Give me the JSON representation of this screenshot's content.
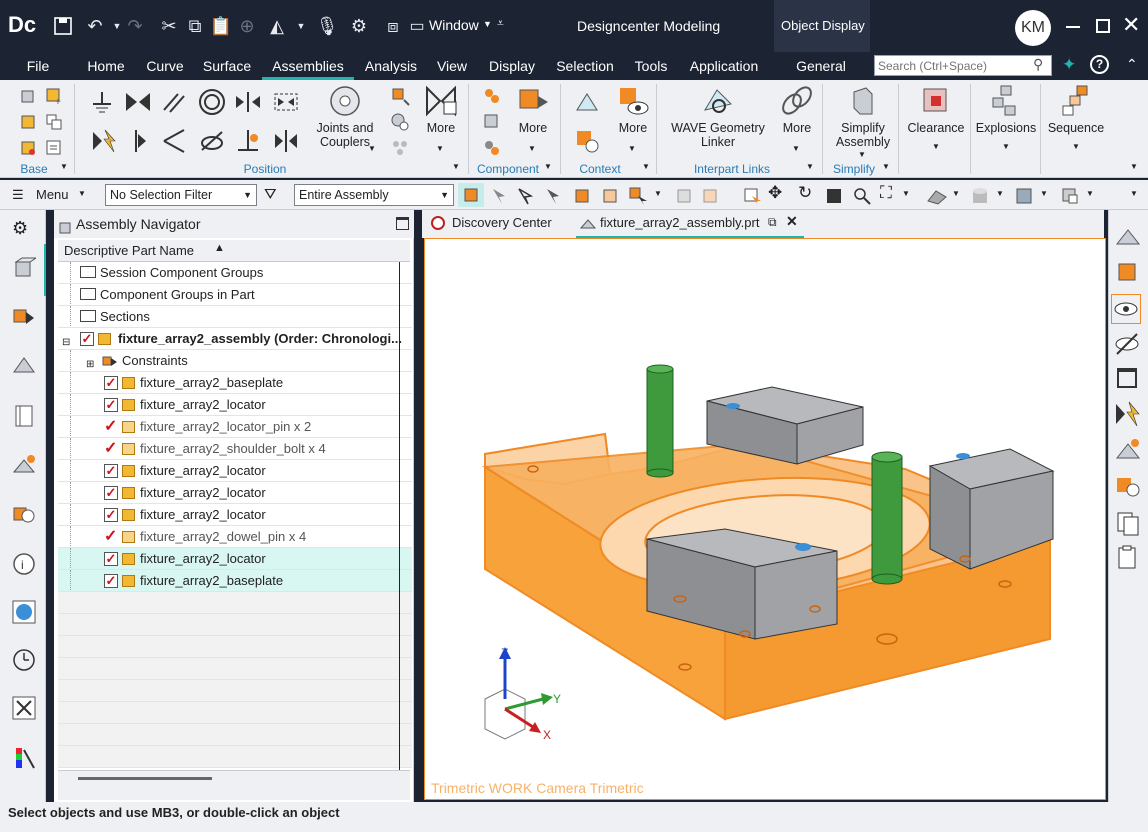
{
  "app": {
    "logo": "Dc",
    "title": "Designcenter Modeling",
    "context_title": "Object Display",
    "window_menu": "Window",
    "user_initials": "KM"
  },
  "menus": {
    "file": "File",
    "home": "Home",
    "curve": "Curve",
    "surface": "Surface",
    "assemblies": "Assemblies",
    "analysis": "Analysis",
    "view": "View",
    "display": "Display",
    "selection": "Selection",
    "tools": "Tools",
    "application": "Application",
    "general": "General"
  },
  "search": {
    "placeholder": "Search (Ctrl+Space)"
  },
  "ribbon": {
    "joints_line1": "Joints and",
    "joints_line2": "Couplers",
    "more": "More",
    "wave_line1": "WAVE Geometry",
    "wave_line2": "Linker",
    "simplify_line1": "Simplify",
    "simplify_line2": "Assembly",
    "clearance": "Clearance",
    "explosions": "Explosions",
    "sequence": "Sequence",
    "groups": {
      "base": "Base",
      "position": "Position",
      "component": "Component",
      "context": "Context",
      "interpart": "Interpart Links",
      "simplify": "Simplify"
    }
  },
  "cmdbar": {
    "menu": "Menu",
    "selection_filter": "No Selection Filter",
    "scope": "Entire Assembly"
  },
  "navigator": {
    "title": "Assembly Navigator",
    "column": "Descriptive Part Name",
    "rows": [
      {
        "label": "Session Component Groups",
        "kind": "folder"
      },
      {
        "label": "Component Groups in Part",
        "kind": "folder"
      },
      {
        "label": "Sections",
        "kind": "folder"
      },
      {
        "label": "fixture_array2_assembly (Order: Chronologi...",
        "kind": "root"
      },
      {
        "label": "Constraints",
        "kind": "constraints"
      },
      {
        "label": "fixture_array2_baseplate",
        "kind": "part"
      },
      {
        "label": "fixture_array2_locator",
        "kind": "part"
      },
      {
        "label": "fixture_array2_locator_pin x 2",
        "kind": "pattern"
      },
      {
        "label": "fixture_array2_shoulder_bolt x 4",
        "kind": "pattern"
      },
      {
        "label": "fixture_array2_locator",
        "kind": "part"
      },
      {
        "label": "fixture_array2_locator",
        "kind": "part"
      },
      {
        "label": "fixture_array2_locator",
        "kind": "part"
      },
      {
        "label": "fixture_array2_dowel_pin x 4",
        "kind": "pattern"
      },
      {
        "label": "fixture_array2_locator",
        "kind": "part-sel"
      },
      {
        "label": "fixture_array2_baseplate",
        "kind": "part-sel"
      }
    ]
  },
  "tabs": {
    "discovery": "Discovery Center",
    "part": "fixture_array2_assembly.prt"
  },
  "viewport": {
    "camera_label": "Trimetric WORK Camera Trimetric",
    "axis_x": "X",
    "axis_y": "Y",
    "axis_z": "Z"
  },
  "status": {
    "message": "Select objects and use MB3, or double-click an object"
  },
  "colors": {
    "accent": "#1fb5ad",
    "titlebar": "#1c2333",
    "model_orange": "#f7a23a",
    "locator_gray": "#8d8f93",
    "pin_green": "#3f9a3d"
  }
}
